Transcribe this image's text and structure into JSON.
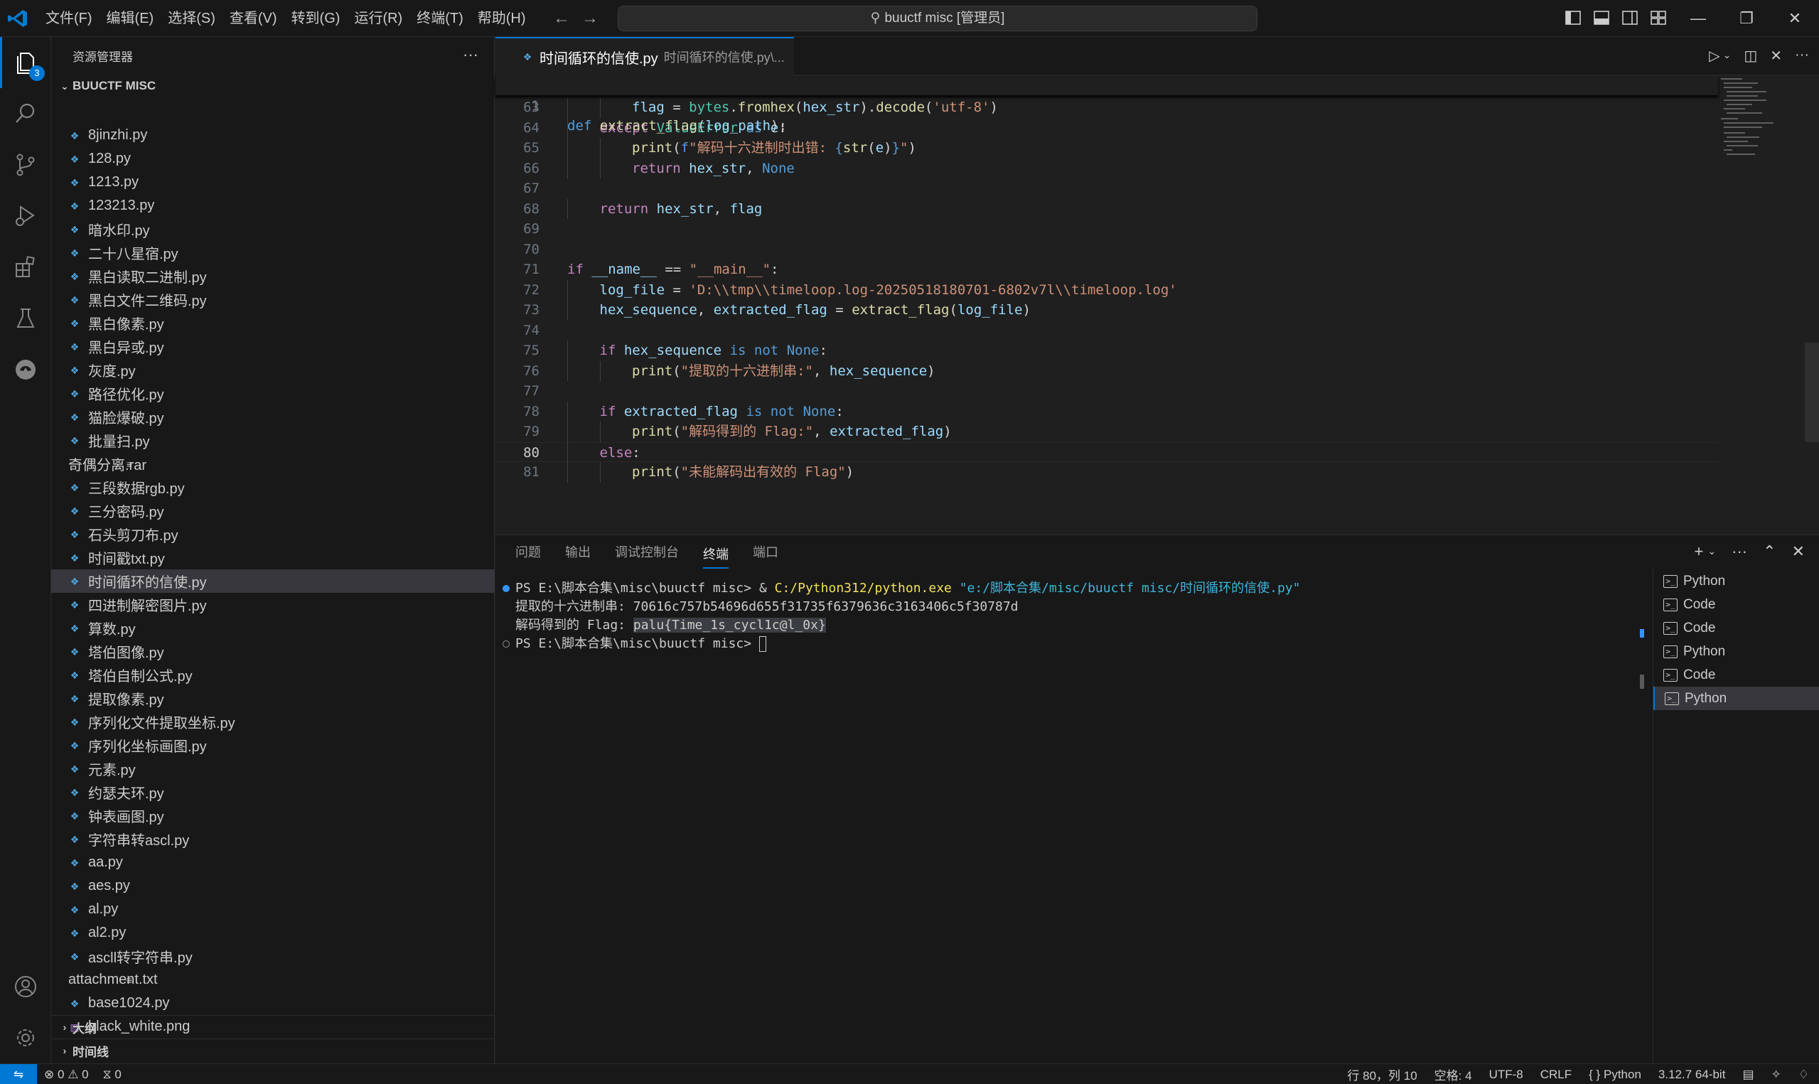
{
  "menubar": [
    "文件(F)",
    "编辑(E)",
    "选择(S)",
    "查看(V)",
    "转到(G)",
    "运行(R)",
    "终端(T)",
    "帮助(H)"
  ],
  "command_center": "buuctf misc [管理员]",
  "activity": {
    "explorer_badge": "3"
  },
  "sidebar": {
    "title": "资源管理器",
    "folder": "BUUCTF MISC",
    "files": [
      {
        "name": "8jinzhi.py",
        "type": "py"
      },
      {
        "name": "128.py",
        "type": "py"
      },
      {
        "name": "1213.py",
        "type": "py"
      },
      {
        "name": "123213.py",
        "type": "py"
      },
      {
        "name": "暗水印.py",
        "type": "py"
      },
      {
        "name": "二十八星宿.py",
        "type": "py"
      },
      {
        "name": "黑白读取二进制.py",
        "type": "py"
      },
      {
        "name": "黑白文件二维码.py",
        "type": "py"
      },
      {
        "name": "黑白像素.py",
        "type": "py"
      },
      {
        "name": "黑白异或.py",
        "type": "py"
      },
      {
        "name": "灰度.py",
        "type": "py"
      },
      {
        "name": "路径优化.py",
        "type": "py"
      },
      {
        "name": "猫脸爆破.py",
        "type": "py"
      },
      {
        "name": "批量扫.py",
        "type": "py"
      },
      {
        "name": "奇偶分离.rar",
        "type": "txt"
      },
      {
        "name": "三段数据rgb.py",
        "type": "py"
      },
      {
        "name": "三分密码.py",
        "type": "py"
      },
      {
        "name": "石头剪刀布.py",
        "type": "py"
      },
      {
        "name": "时间戳txt.py",
        "type": "py"
      },
      {
        "name": "时间循环的信使.py",
        "type": "py",
        "selected": true
      },
      {
        "name": "四进制解密图片.py",
        "type": "py"
      },
      {
        "name": "算数.py",
        "type": "py"
      },
      {
        "name": "塔伯图像.py",
        "type": "py"
      },
      {
        "name": "塔伯自制公式.py",
        "type": "py"
      },
      {
        "name": "提取像素.py",
        "type": "py"
      },
      {
        "name": "序列化文件提取坐标.py",
        "type": "py"
      },
      {
        "name": "序列化坐标画图.py",
        "type": "py"
      },
      {
        "name": "元素.py",
        "type": "py"
      },
      {
        "name": "约瑟夫环.py",
        "type": "py"
      },
      {
        "name": "钟表画图.py",
        "type": "py"
      },
      {
        "name": "字符串转ascl.py",
        "type": "py"
      },
      {
        "name": "aa.py",
        "type": "py"
      },
      {
        "name": "aes.py",
        "type": "py"
      },
      {
        "name": "al.py",
        "type": "py"
      },
      {
        "name": "al2.py",
        "type": "py"
      },
      {
        "name": "ascll转字符串.py",
        "type": "py"
      },
      {
        "name": "attachment.txt",
        "type": "txt"
      },
      {
        "name": "base1024.py",
        "type": "py"
      },
      {
        "name": "black_white.png",
        "type": "img"
      }
    ],
    "outline": "大纲",
    "timeline": "时间线"
  },
  "editor": {
    "tab_name": "时间循环的信使.py",
    "tab_path": "时间循环的信使.py\\...",
    "sticky": {
      "line": "1",
      "code": "def extract_flag(log_path):"
    },
    "lines": [
      {
        "n": "63",
        "indent": 2,
        "code": "flag = bytes.fromhex(hex_str).decode('utf-8')"
      },
      {
        "n": "64",
        "indent": 1,
        "code": "except ValueError as e:"
      },
      {
        "n": "65",
        "indent": 2,
        "code": "print(f\"解码十六进制时出错: {str(e)}\")"
      },
      {
        "n": "66",
        "indent": 2,
        "code": "return hex_str, None"
      },
      {
        "n": "67",
        "indent": 0,
        "code": ""
      },
      {
        "n": "68",
        "indent": 1,
        "code": "return hex_str, flag"
      },
      {
        "n": "69",
        "indent": 0,
        "code": ""
      },
      {
        "n": "70",
        "indent": 0,
        "code": ""
      },
      {
        "n": "71",
        "indent": 0,
        "code": "if __name__ == \"__main__\":"
      },
      {
        "n": "72",
        "indent": 1,
        "code": "log_file = 'D:\\\\tmp\\\\timeloop.log-20250518180701-6802v7l\\\\timeloop.log'"
      },
      {
        "n": "73",
        "indent": 1,
        "code": "hex_sequence, extracted_flag = extract_flag(log_file)"
      },
      {
        "n": "74",
        "indent": 0,
        "code": ""
      },
      {
        "n": "75",
        "indent": 1,
        "code": "if hex_sequence is not None:"
      },
      {
        "n": "76",
        "indent": 2,
        "code": "print(\"提取的十六进制串:\", hex_sequence)"
      },
      {
        "n": "77",
        "indent": 0,
        "code": ""
      },
      {
        "n": "78",
        "indent": 1,
        "code": "if extracted_flag is not None:"
      },
      {
        "n": "79",
        "indent": 2,
        "code": "print(\"解码得到的 Flag:\", extracted_flag)"
      },
      {
        "n": "80",
        "indent": 1,
        "code": "else:",
        "current": true
      },
      {
        "n": "81",
        "indent": 2,
        "code": "print(\"未能解码出有效的 Flag\")"
      }
    ]
  },
  "panel": {
    "tabs": [
      "问题",
      "输出",
      "调试控制台",
      "终端",
      "端口"
    ],
    "active_tab": "终端",
    "terminal": {
      "l1_prompt": "PS E:\\脚本合集\\misc\\buuctf misc> ",
      "l1_amp": "& ",
      "l1_exe": "C:/Python312/python.exe",
      "l1_arg": " \"e:/脚本合集/misc/buuctf misc/时间循环的信使.py\"",
      "l2": "提取的十六进制串: 70616c757b54696d655f31735f6379636c3163406c5f30787d",
      "l3_prefix": "解码得到的 Flag: ",
      "l3_flag": "palu{Time_1s_cycl1c@l_0x}",
      "l4_prompt": "PS E:\\脚本合集\\misc\\buuctf misc> "
    },
    "terminals": [
      "Python",
      "Code",
      "Code",
      "Python",
      "Code",
      "Python"
    ]
  },
  "statusbar": {
    "errors": "0",
    "warnings": "0",
    "ports": "0",
    "position": "行 80，列 10",
    "spaces": "空格: 4",
    "encoding": "UTF-8",
    "eol": "CRLF",
    "language": "Python",
    "interpreter": "3.12.7 64-bit"
  }
}
